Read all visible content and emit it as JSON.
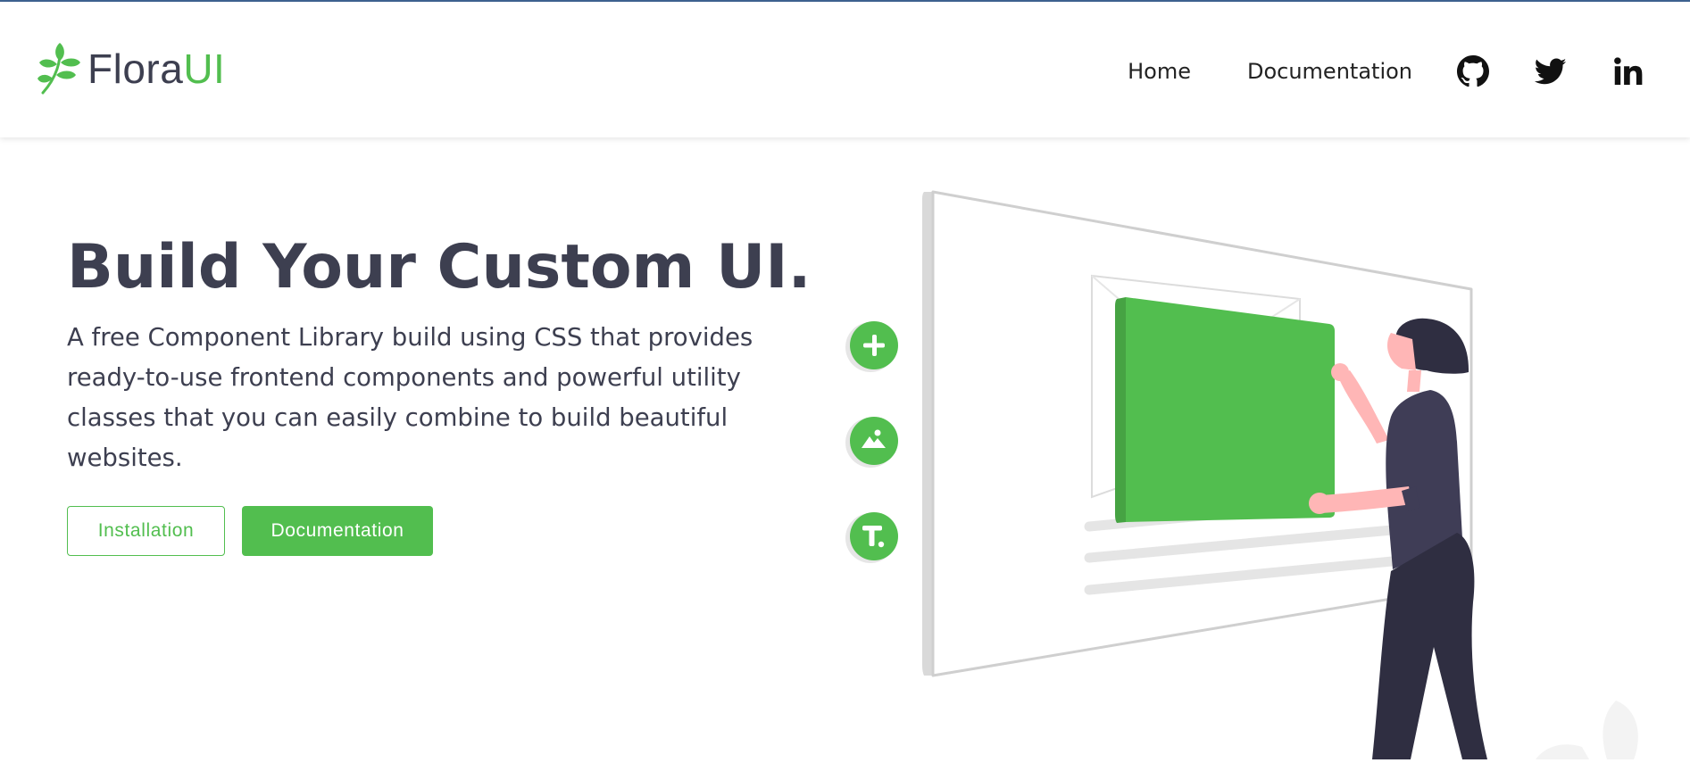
{
  "brand": {
    "name_part1": "Flora",
    "name_part2": "UI",
    "logo_icon": "leaf-sprig-icon"
  },
  "nav": {
    "links": [
      {
        "label": "Home"
      },
      {
        "label": "Documentation"
      }
    ],
    "social_icons": [
      "github-icon",
      "twitter-icon",
      "linkedin-icon"
    ]
  },
  "hero": {
    "title": "Build Your Custom UI.",
    "description": "A free Component Library build using CSS that provides ready-to-use frontend components and powerful utility classes that you can easily combine to build beautiful websites.",
    "buttons": {
      "installation": "Installation",
      "documentation": "Documentation"
    }
  },
  "illustration": {
    "tool_icons": [
      "plus-icon",
      "image-icon",
      "text-icon"
    ]
  },
  "colors": {
    "brand_green": "#52be4f",
    "text_dark": "#3d3f50",
    "top_accent": "#3e6391"
  }
}
